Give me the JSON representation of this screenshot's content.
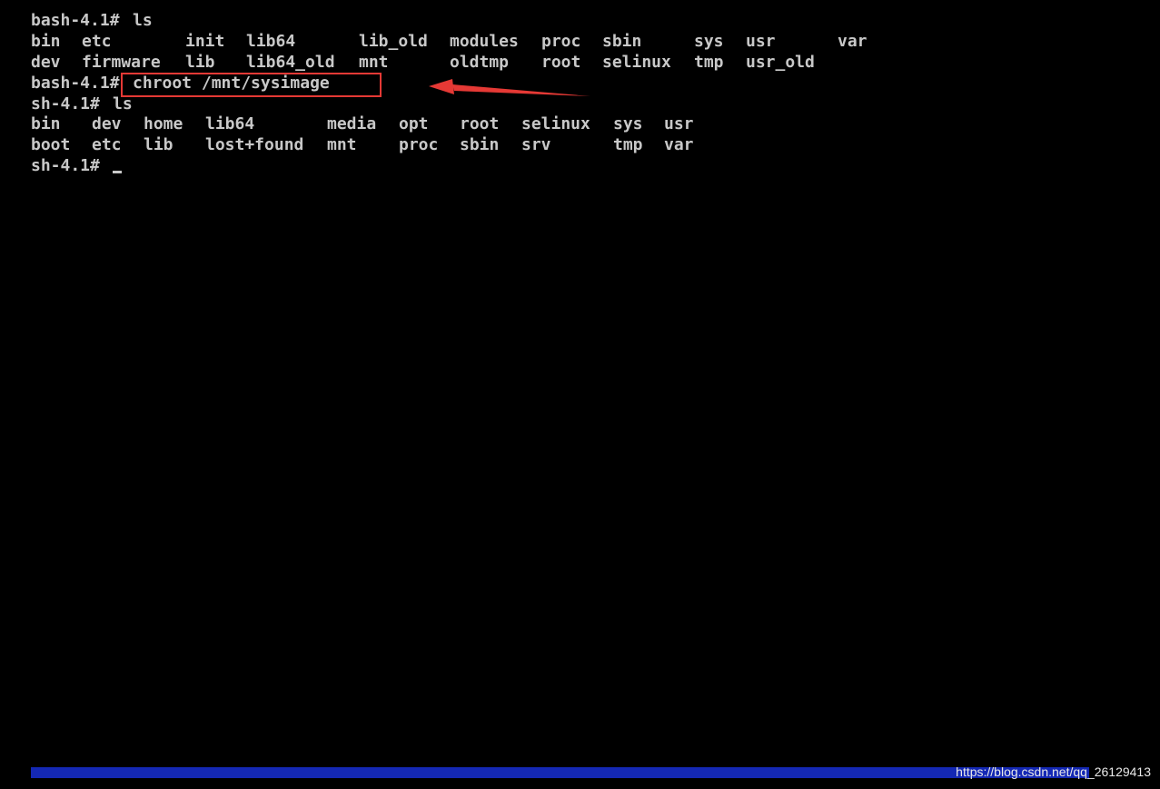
{
  "terminal": {
    "lines": [
      {
        "prompt": "bash-4.1# ",
        "command": "ls"
      },
      {
        "entries": [
          "bin",
          "etc",
          "init",
          "lib64",
          "lib_old",
          "modules",
          "proc",
          "sbin",
          "sys",
          "usr",
          "var"
        ]
      },
      {
        "entries": [
          "dev",
          "firmware",
          "lib",
          "lib64_old",
          "mnt",
          "oldtmp",
          "root",
          "selinux",
          "tmp",
          "usr_old"
        ]
      },
      {
        "prompt": "bash-4.1# ",
        "command": "chroot /mnt/sysimage"
      },
      {
        "prompt": "sh-4.1# ",
        "command": "ls"
      },
      {
        "entries": [
          "bin",
          "dev",
          "home",
          "lib64",
          "media",
          "opt",
          "root",
          "selinux",
          "sys",
          "usr"
        ]
      },
      {
        "entries": [
          "boot",
          "etc",
          "lib",
          "lost+found",
          "mnt",
          "proc",
          "sbin",
          "srv",
          "tmp",
          "var"
        ]
      },
      {
        "prompt": "sh-4.1# ",
        "command": ""
      }
    ],
    "text_color": "#c8c8c8",
    "background": "#000000"
  },
  "annotation": {
    "box_color": "#e53935",
    "arrow_color": "#e53935",
    "highlighted_command": "chroot /mnt/sysimage"
  },
  "status_bar": {
    "color": "#1428b4"
  },
  "watermark": {
    "text": "https://blog.csdn.net/qq_26129413"
  }
}
